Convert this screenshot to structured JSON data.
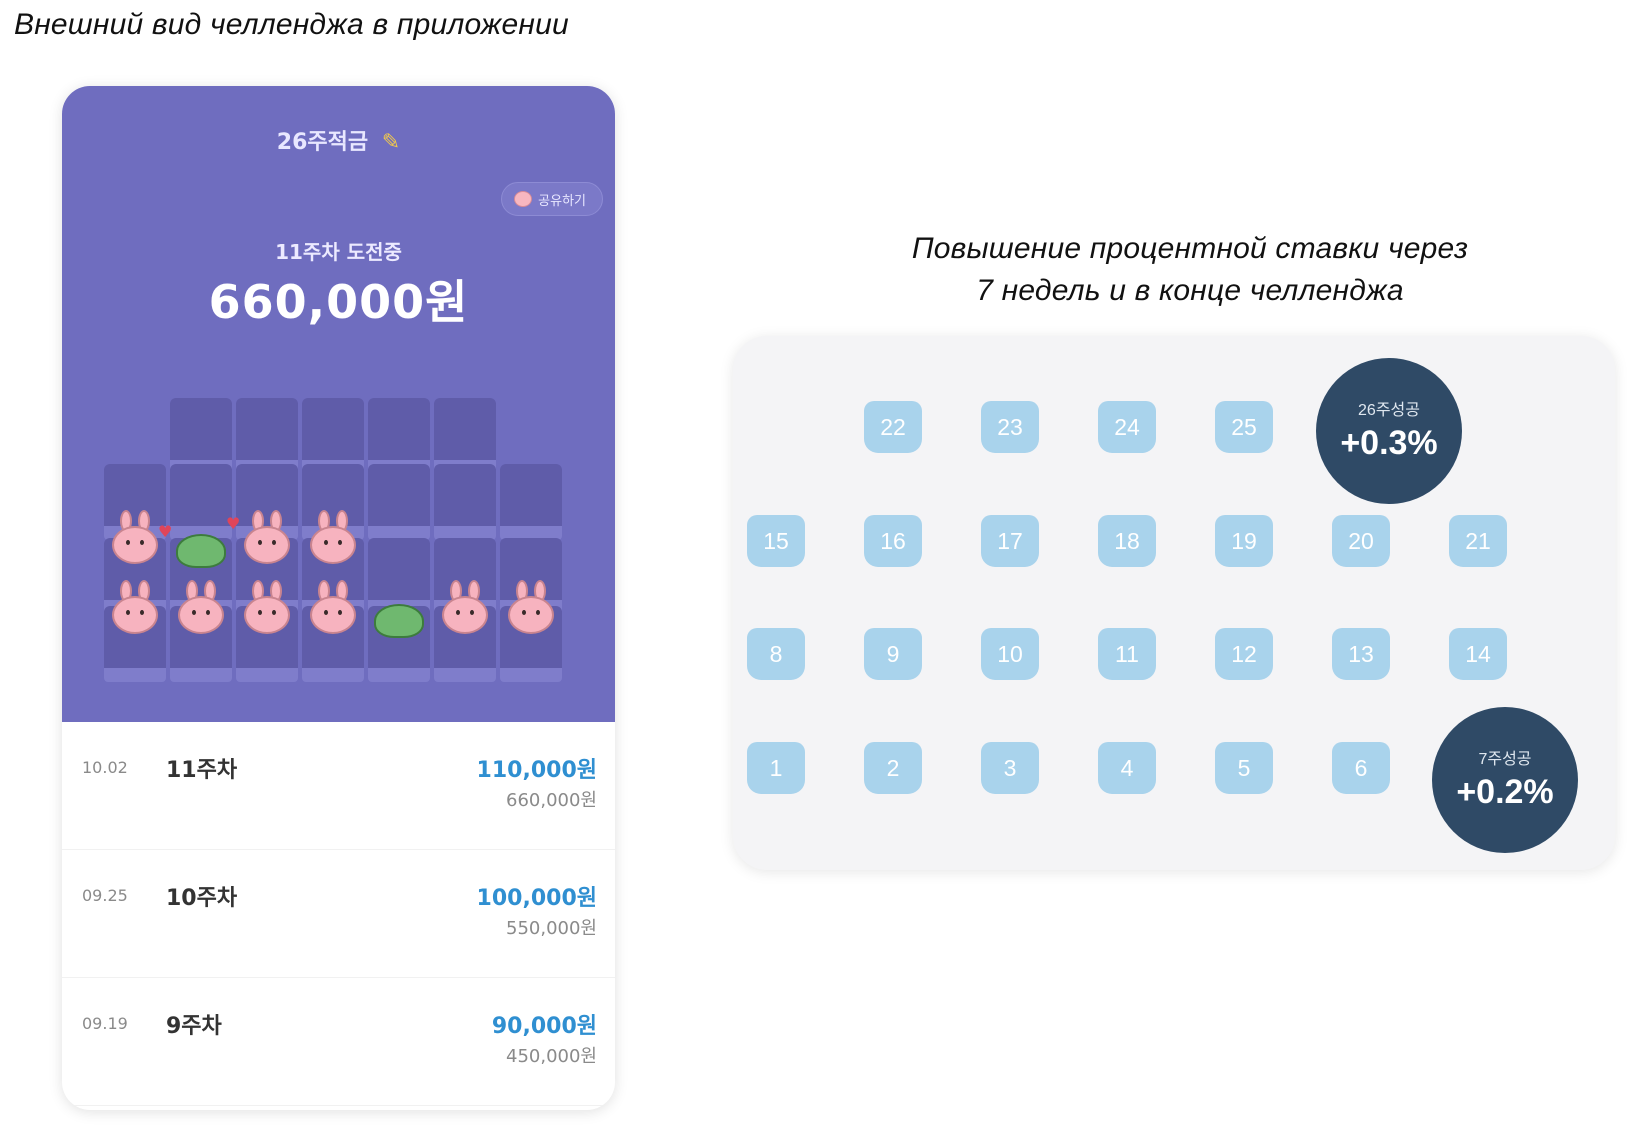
{
  "captions": {
    "left": "Внешний вид челленджа в приложении",
    "right_line1": "Повышение процентной ставки через",
    "right_line2": "7 недель и в конце челленджа"
  },
  "app": {
    "title": "26주적금",
    "title_icon": "pencil-icon",
    "share_label": "공유하기",
    "share_icon": "bunny-icon",
    "week_status": "11주차 도전중",
    "amount": "660,000원",
    "list": [
      {
        "date": "10.02",
        "week": "11주차",
        "paid": "110,000원",
        "total": "660,000원"
      },
      {
        "date": "09.25",
        "week": "10주차",
        "paid": "100,000원",
        "total": "550,000원"
      },
      {
        "date": "09.19",
        "week": "9주차",
        "paid": "90,000원",
        "total": "450,000원"
      }
    ]
  },
  "rates": {
    "cells": [
      "1",
      "2",
      "3",
      "4",
      "5",
      "6",
      "8",
      "9",
      "10",
      "11",
      "12",
      "13",
      "14",
      "15",
      "16",
      "17",
      "18",
      "19",
      "20",
      "21",
      "22",
      "23",
      "24",
      "25"
    ],
    "badge_26": {
      "label": "26주성공",
      "rate": "+0.3%"
    },
    "badge_7": {
      "label": "7주성공",
      "rate": "+0.2%"
    }
  },
  "colors": {
    "header": "#6f6dbf",
    "accent": "#2f8fd1",
    "cell": "#a9d3ec",
    "badge": "#2f4a66"
  }
}
